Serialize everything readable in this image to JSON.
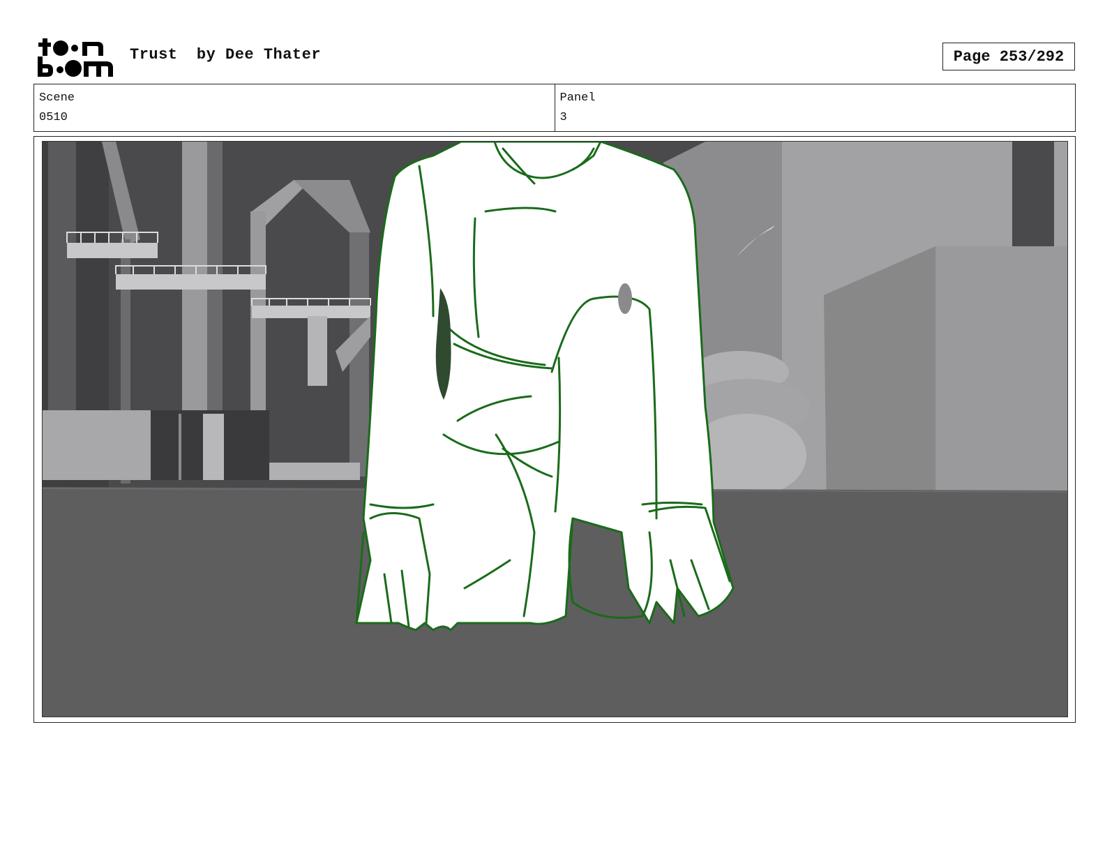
{
  "header": {
    "logo_alt": "toon boom",
    "title": "Trust  by Dee Thater",
    "page_label": "Page 253/292"
  },
  "info": {
    "scene_label": "Scene",
    "scene_value": "0510",
    "panel_label": "Panel",
    "panel_value": "3"
  },
  "colors": {
    "sketch_line": "#1a6b1a",
    "figure_fill": "#ffffff",
    "floor": "#5e5e5e",
    "background_dark": "#454548"
  }
}
